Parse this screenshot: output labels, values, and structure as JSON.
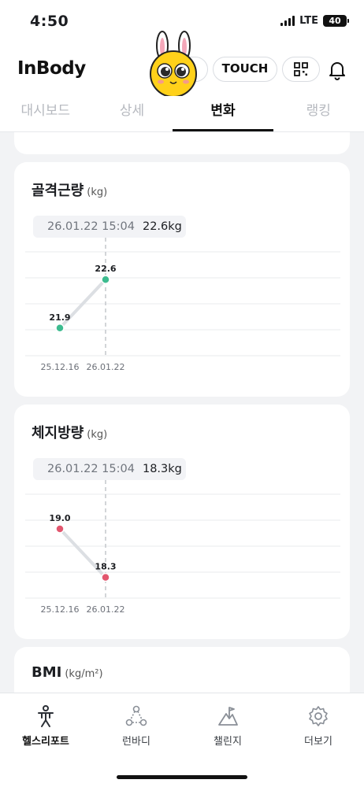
{
  "status_bar": {
    "time": "4:50",
    "network": "LTE",
    "battery": "40"
  },
  "header": {
    "logo": "InBody",
    "touch_label": "TOUCH"
  },
  "tabs": [
    {
      "label": "대시보드"
    },
    {
      "label": "상세"
    },
    {
      "label": "변화",
      "active": true
    },
    {
      "label": "랭킹"
    }
  ],
  "cards": [
    {
      "title": "골격근량",
      "unit": "(kg)",
      "selected": {
        "datetime": "26.01.22 15:04",
        "value": "22.6kg"
      }
    },
    {
      "title": "체지방량",
      "unit": "(kg)",
      "selected": {
        "datetime": "26.01.22 15:04",
        "value": "18.3kg"
      }
    },
    {
      "title": "BMI",
      "unit": "(kg/m²)"
    }
  ],
  "chart_data": [
    {
      "type": "line",
      "x": [
        "25.12.16",
        "26.01.22"
      ],
      "series": [
        {
          "values": [
            21.9,
            22.6
          ],
          "labels": [
            "21.9",
            "22.6"
          ],
          "color": "#3dbb8f"
        }
      ],
      "ylim": [
        21.5,
        23.0
      ],
      "selected_index": 1
    },
    {
      "type": "line",
      "x": [
        "25.12.16",
        "26.01.22"
      ],
      "series": [
        {
          "values": [
            19.0,
            18.3
          ],
          "labels": [
            "19.0",
            "18.3"
          ],
          "color": "#e2566e"
        }
      ],
      "ylim": [
        18.0,
        19.5
      ],
      "selected_index": 1
    }
  ],
  "bottom_nav": [
    {
      "label": "헬스리포트",
      "icon": "health-report-icon",
      "active": true
    },
    {
      "label": "런바디",
      "icon": "runbody-icon"
    },
    {
      "label": "챌린지",
      "icon": "challenge-icon"
    },
    {
      "label": "더보기",
      "icon": "more-settings-icon"
    }
  ]
}
